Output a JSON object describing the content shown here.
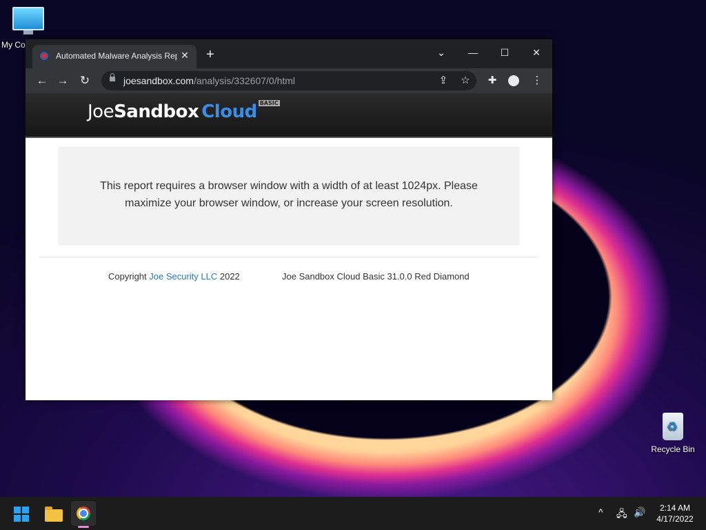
{
  "desktop": {
    "icons": [
      {
        "label": "My Co"
      },
      {
        "label": "Recycle Bin"
      }
    ]
  },
  "browser": {
    "tab": {
      "title": "Automated Malware Analysis Rep",
      "close": "✕"
    },
    "new_tab": "+",
    "window_controls": {
      "tab_search": "⌄",
      "minimize": "—",
      "maximize": "☐",
      "close": "✕"
    },
    "nav": {
      "back": "←",
      "forward": "→",
      "reload": "↻"
    },
    "address": {
      "domain": "joesandbox.com",
      "path": "/analysis/332607/0/html"
    },
    "omnibox_icons": {
      "share": "⇪",
      "bookmark": "☆"
    },
    "toolbar_icons": {
      "extensions": "✚",
      "menu": "⋮"
    }
  },
  "page": {
    "logo": {
      "joe": "Joe",
      "sandbox": "Sandbox",
      "cloud": "Cloud",
      "badge": "BASIC"
    },
    "notice": "This report requires a browser window with a width of at least 1024px. Please maximize your browser window, or increase your screen resolution.",
    "footer": {
      "copyright_prefix": "Copyright ",
      "company_link": "Joe Security LLC",
      "year": " 2022",
      "version": "Joe Sandbox Cloud Basic 31.0.0 Red Diamond"
    }
  },
  "taskbar": {
    "tray": {
      "chevron": "^",
      "network": "🖧",
      "volume": "🔊"
    },
    "clock": {
      "time": "2:14 AM",
      "date": "4/17/2022"
    }
  },
  "colors": {
    "chrome_dark": "#202124",
    "chrome_toolbar": "#35363a",
    "link": "#2a7ab8",
    "logo_cloud": "#3a8ee6"
  }
}
